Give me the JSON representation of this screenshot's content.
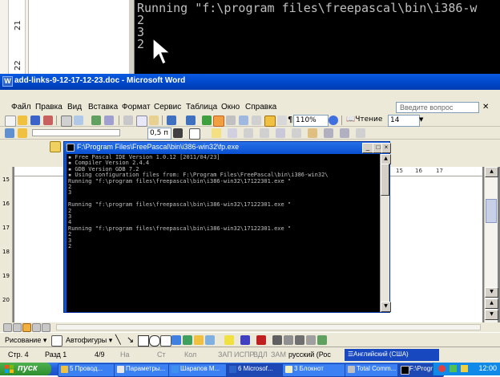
{
  "top_console": {
    "lines": [
      "Running \"f:\\program files\\freepascal\\bin\\i386-w",
      "2",
      "3",
      "2"
    ]
  },
  "top_ruler": {
    "ticks": [
      "21",
      "22"
    ]
  },
  "word": {
    "title": "add-links-9-12-17-12-23.doc - Microsoft Word",
    "menu": [
      "Файл",
      "Правка",
      "Вид",
      "Вставка",
      "Формат",
      "Сервис",
      "Таблица",
      "Окно",
      "Справка"
    ],
    "help_placeholder": "Введите вопрос",
    "toolbar": {
      "zoom": "110%",
      "reading_label": "Чтение",
      "font_size": "14",
      "line_width": "0,5 п"
    },
    "ruler_marks": [
      "15",
      "16",
      "17"
    ],
    "vruler_marks": [
      "15",
      "16",
      "17",
      "18",
      "19",
      "20"
    ],
    "drawing_bar": {
      "drawing_label": "Рисование",
      "autoshapes_label": "Автофигуры"
    },
    "status": {
      "page": "Стр. 4",
      "section": "Разд 1",
      "pages": "4/9",
      "at": "На",
      "ln": "Ст",
      "col": "Кол",
      "rec": "ЗАП",
      "trk": "ИСПР",
      "ext": "ВДЛ",
      "ovr": "ЗАМ",
      "lang": "русский (Рос",
      "kbd": "Английский (США)"
    }
  },
  "console": {
    "title": "F:\\Program Files\\FreePascal\\bin\\i386-win32\\fp.exe",
    "lines": [
      "▪ Free Pascal IDE Version 1.0.12 [2011/04/23]",
      "▪ Compiler Version 2.4.4",
      "▪ GDB Version GDB 7.2",
      "▪ Using configuration files from: F:\\Program Files\\FreePascal\\bin\\i386-win32\\",
      "Running \"f:\\program files\\freepascal\\bin\\i386-win32\\17122301.exe \"",
      "2",
      "3",
      "",
      "Running \"f:\\program files\\freepascal\\bin\\i386-win32\\17122301.exe \"",
      "2",
      "3",
      "4",
      "Running \"f:\\program files\\freepascal\\bin\\i386-win32\\17122301.exe \"",
      "2",
      "3",
      "2"
    ]
  },
  "taskbar": {
    "start_label": "пуск",
    "tasks": [
      {
        "label": "5 Провод...",
        "icon_color": "#f0c040"
      },
      {
        "label": "Параметры...",
        "icon_color": "#e8e8e8"
      },
      {
        "label": "Шарапов М...",
        "icon_color": "#4090f0"
      },
      {
        "label": "6 Microsof...",
        "icon_color": "#2a62c8"
      },
      {
        "label": "3 Блокнот",
        "icon_color": "#f0f0c0"
      },
      {
        "label": "Total Comm...",
        "icon_color": "#c0c0c0"
      },
      {
        "label": "F:\\Program ...",
        "icon_color": "#000000"
      }
    ],
    "clock": "12:00"
  },
  "colors": {
    "title_blue": "#0046c8",
    "taskbar_blue": "#245edc",
    "start_green": "#3a9a3a"
  }
}
